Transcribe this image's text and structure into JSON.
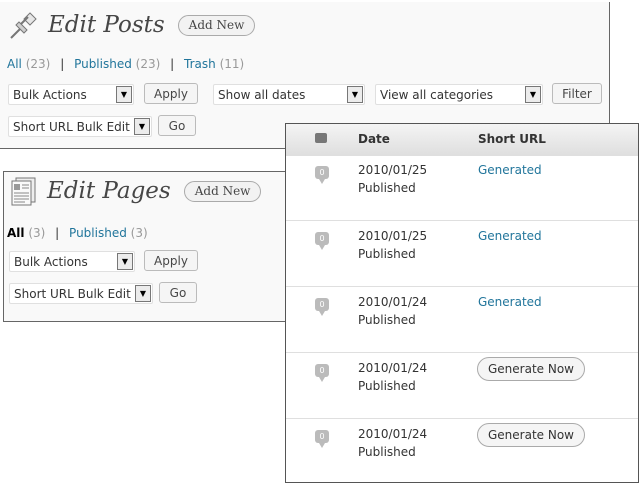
{
  "posts": {
    "title": "Edit Posts",
    "add_new": "Add New",
    "icon": "pushpin-icon",
    "filters": {
      "all": "All",
      "all_count": "(23)",
      "published": "Published",
      "published_count": "(23)",
      "trash": "Trash",
      "trash_count": "(11)",
      "separator": "|"
    },
    "bulk_actions": "Bulk Actions",
    "apply": "Apply",
    "dates": "Show all dates",
    "categories": "View all categories",
    "filter": "Filter",
    "short_url_bulk": "Short URL Bulk Edit",
    "go": "Go"
  },
  "pages": {
    "title": "Edit Pages",
    "add_new": "Add New",
    "icon": "pages-icon",
    "filters": {
      "all": "All",
      "all_count": "(3)",
      "published": "Published",
      "published_count": "(3)",
      "separator": "|"
    },
    "bulk_actions": "Bulk Actions",
    "apply": "Apply",
    "short_url_bulk": "Short URL Bulk Edit",
    "go": "Go"
  },
  "table": {
    "comments_icon": "comment-bubble-icon",
    "columns": {
      "date": "Date",
      "short_url": "Short URL"
    },
    "rows": [
      {
        "comments": "0",
        "date": "2010/01/25",
        "status": "Published",
        "short_url": "Generated",
        "action": null
      },
      {
        "comments": "0",
        "date": "2010/01/25",
        "status": "Published",
        "short_url": "Generated",
        "action": null
      },
      {
        "comments": "0",
        "date": "2010/01/24",
        "status": "Published",
        "short_url": "Generated",
        "action": null
      },
      {
        "comments": "0",
        "date": "2010/01/24",
        "status": "Published",
        "short_url": null,
        "action": "Generate Now"
      },
      {
        "comments": "0",
        "date": "2010/01/24",
        "status": "Published",
        "short_url": null,
        "action": "Generate Now"
      }
    ]
  },
  "colors": {
    "link": "#21759b",
    "panel_bg": "#f9f9f9",
    "header_bg": "#dfdfdf"
  }
}
